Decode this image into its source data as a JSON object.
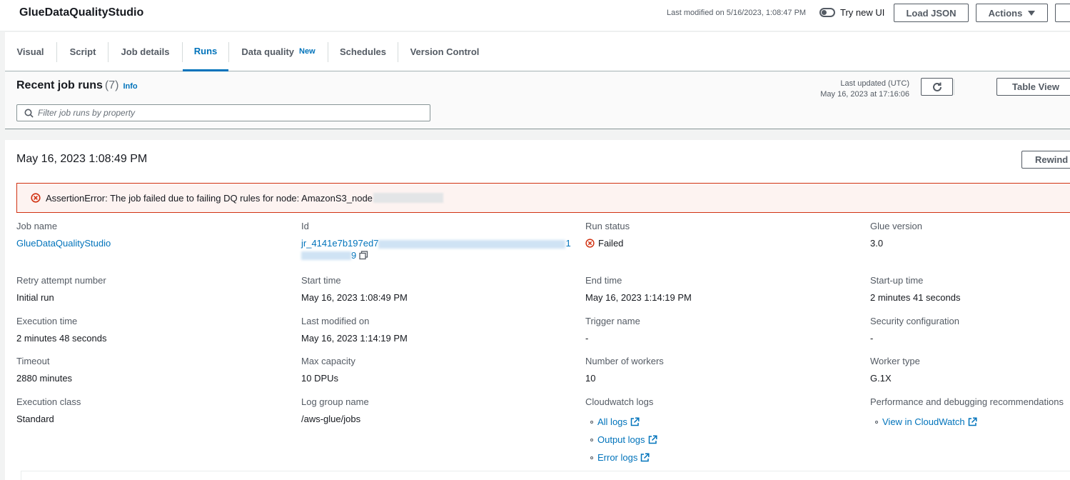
{
  "header": {
    "app_title": "GlueDataQualityStudio",
    "last_modified": "Last modified on 5/16/2023, 1:08:47 PM",
    "try_new_ui": "Try new UI",
    "load_json": "Load JSON",
    "actions": "Actions"
  },
  "tabs": [
    {
      "label": "Visual"
    },
    {
      "label": "Script"
    },
    {
      "label": "Job details"
    },
    {
      "label": "Runs",
      "active": true
    },
    {
      "label": "Data quality",
      "badge": "New"
    },
    {
      "label": "Schedules"
    },
    {
      "label": "Version Control"
    }
  ],
  "runs": {
    "title": "Recent job runs",
    "count": "(7)",
    "info": "Info",
    "last_updated_label": "Last updated (UTC)",
    "last_updated_value": "May 16, 2023 at 17:16:06",
    "table_view": "Table View",
    "filter_placeholder": "Filter job runs by property"
  },
  "detail": {
    "run_date": "May 16, 2023 1:08:49 PM",
    "rewind": "Rewind",
    "alert": "AssertionError: The job failed due to failing DQ rules for node: AmazonS3_node",
    "fields": {
      "job_name": {
        "label": "Job name",
        "value": "GlueDataQualityStudio"
      },
      "id": {
        "label": "Id",
        "value_start": "jr_4141e7b197ed7",
        "value_end_line1": "1",
        "value_end_line2": "9"
      },
      "run_status": {
        "label": "Run status",
        "value": "Failed"
      },
      "glue_version": {
        "label": "Glue version",
        "value": "3.0"
      },
      "retry": {
        "label": "Retry attempt number",
        "value": "Initial run"
      },
      "start_time": {
        "label": "Start time",
        "value": "May 16, 2023 1:08:49 PM"
      },
      "end_time": {
        "label": "End time",
        "value": "May 16, 2023 1:14:19 PM"
      },
      "startup_time": {
        "label": "Start-up time",
        "value": "2 minutes 41 seconds"
      },
      "execution_time": {
        "label": "Execution time",
        "value": "2 minutes 48 seconds"
      },
      "last_modified": {
        "label": "Last modified on",
        "value": "May 16, 2023 1:14:19 PM"
      },
      "trigger": {
        "label": "Trigger name",
        "value": "-"
      },
      "security": {
        "label": "Security configuration",
        "value": "-"
      },
      "timeout": {
        "label": "Timeout",
        "value": "2880 minutes"
      },
      "max_capacity": {
        "label": "Max capacity",
        "value": "10 DPUs"
      },
      "workers": {
        "label": "Number of workers",
        "value": "10"
      },
      "worker_type": {
        "label": "Worker type",
        "value": "G.1X"
      },
      "execution_class": {
        "label": "Execution class",
        "value": "Standard"
      },
      "log_group": {
        "label": "Log group name",
        "value": "/aws-glue/jobs"
      },
      "cloudwatch": {
        "label": "Cloudwatch logs",
        "links": [
          "All logs",
          "Output logs",
          "Error logs"
        ]
      },
      "perf": {
        "label": "Performance and debugging recommendations",
        "link": "View in CloudWatch"
      }
    }
  },
  "colors": {
    "link": "#0073bb",
    "error": "#d13212",
    "alert_bg": "#fdf3f1",
    "text": "#16191f",
    "secondary": "#545b64"
  },
  "icons": [
    "search-icon",
    "refresh-icon",
    "error-icon",
    "copy-icon",
    "external-link-icon",
    "caret-down-icon"
  ]
}
